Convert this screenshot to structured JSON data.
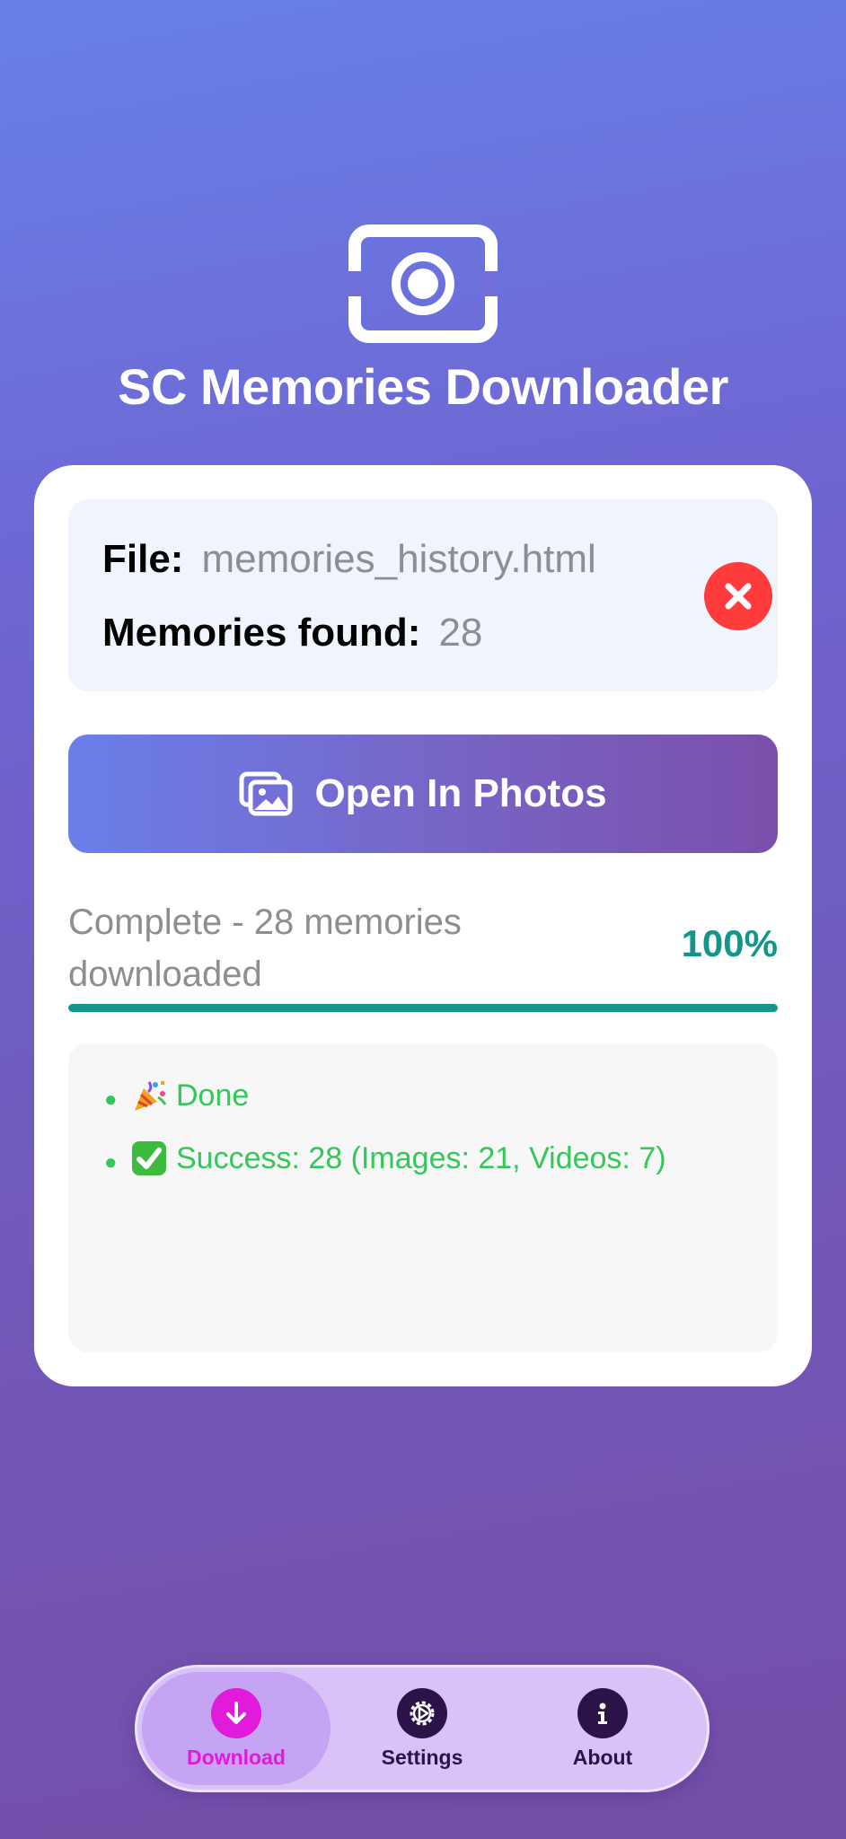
{
  "app": {
    "title": "SC Memories Downloader",
    "logo_icon": "camera-frame-icon"
  },
  "file_info": {
    "file_label": "File:",
    "file_value": "memories_history.html",
    "memories_label": "Memories found:",
    "memories_value": "28",
    "clear_icon": "close-icon"
  },
  "actions": {
    "open_photos_label": "Open In Photos",
    "open_photos_icon": "photos-icon"
  },
  "progress": {
    "status_text": "Complete - 28 memories downloaded",
    "percent_text": "100%",
    "fraction": 1.0
  },
  "log": {
    "items": [
      {
        "emoji": "party-popper-icon",
        "text": "Done"
      },
      {
        "emoji": "check-mark-icon",
        "text": "Success: 28 (Images: 21, Videos: 7)"
      }
    ]
  },
  "tab_bar": {
    "tabs": [
      {
        "label": "Download",
        "icon": "download-arrow-icon",
        "selected": true
      },
      {
        "label": "Settings",
        "icon": "gear-icon",
        "selected": false
      },
      {
        "label": "About",
        "icon": "info-icon",
        "selected": false
      }
    ]
  },
  "colors": {
    "accent_teal": "#12968a",
    "success_green": "#34c759",
    "destructive_red": "#ff3b3b",
    "tab_selected": "#e21ad9",
    "tab_default": "#2b1347"
  }
}
